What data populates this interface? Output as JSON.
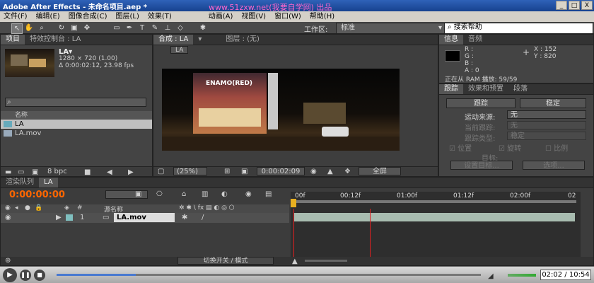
{
  "window": {
    "title": "Adobe After Effects - 未命名项目.aep *",
    "min": "_",
    "max": "□",
    "close": "X"
  },
  "watermark": "www.51zxw.net(我要自学网) 出品",
  "menu": [
    "文件(F)",
    "编辑(E)",
    "图像合成(C)",
    "图层(L)",
    "效果(T)",
    "动画(A)",
    "视图(V)",
    "窗口(W)",
    "帮助(H)"
  ],
  "toolbar": {
    "workspace_label": "工作区:",
    "workspace_value": "标准",
    "search_placeholder": "搜索帮助"
  },
  "project": {
    "tabs": [
      "项目",
      "特效控制台 : LA"
    ],
    "item_name": "LA▾",
    "item_size": "1280 × 720 (1.00)",
    "item_duration": "Δ 0:00:02:12, 23.98 fps",
    "col_name": "名称",
    "items": [
      "LA",
      "LA.mov"
    ],
    "bpc": "8 bpc"
  },
  "composition": {
    "tab_comp": "合成 : LA",
    "tab_layer": "图层 : (无)",
    "chip": "LA",
    "zoom": "(25%)",
    "timecode": "0:00:02:09",
    "fullres": "全屏"
  },
  "info": {
    "tabs": [
      "信息",
      "音频"
    ],
    "r": "R :",
    "g": "G :",
    "b": "B :",
    "a": "A : 0",
    "x": "X : 152",
    "y": "Y : 820",
    "status": "正在从 RAM 播放: 59/59"
  },
  "tracker": {
    "tabs": [
      "跟踪",
      "效果和预置",
      "段落"
    ],
    "track_btn": "跟踪",
    "stabilize_btn": "稳定",
    "motion_source_label": "运动来源:",
    "motion_source_value": "无",
    "current_track_label": "当前跟踪:",
    "current_track_value": "无",
    "track_type_label": "跟踪类型:",
    "track_type_value": "稳定",
    "position": "位置",
    "rotation": "旋转",
    "scale": "比例",
    "target_label": "目标:",
    "set_target_btn": "设置目标...",
    "options_btn": "选项..."
  },
  "timeline": {
    "tabs": [
      "渲染队列",
      "LA"
    ],
    "timecode": "0:00:00:00",
    "col_source": "源名称",
    "layer_index": "1",
    "layer_name": "LA.mov",
    "toggle_label": "切换开关 / 模式",
    "ruler": [
      "00f",
      "00:12f",
      "01:00f",
      "01:12f",
      "02:00f",
      "02"
    ]
  },
  "player": {
    "time": "02:02 / 10:54"
  }
}
